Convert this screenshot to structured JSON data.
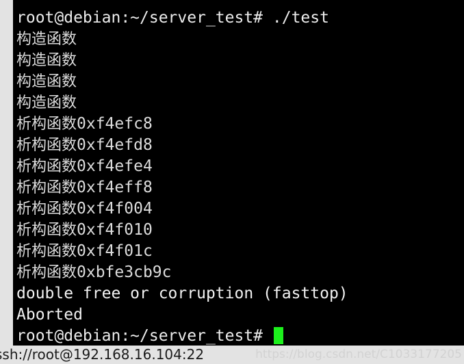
{
  "terminal": {
    "background_color": "#000000",
    "foreground_color": "#e8e8e8",
    "cursor_color": "#1cf01c",
    "lines": [
      {
        "type": "prompt",
        "text": "root@debian:~/server_test# ./test"
      },
      {
        "type": "cjk",
        "text": "构造函数"
      },
      {
        "type": "cjk",
        "text": "构造函数"
      },
      {
        "type": "cjk",
        "text": "构造函数"
      },
      {
        "type": "cjk",
        "text": "构造函数"
      },
      {
        "type": "cjk-addr",
        "cjk": "析构函数",
        "addr": "0xf4efc8"
      },
      {
        "type": "cjk-addr",
        "cjk": "析构函数",
        "addr": "0xf4efd8"
      },
      {
        "type": "cjk-addr",
        "cjk": "析构函数",
        "addr": "0xf4efe4"
      },
      {
        "type": "cjk-addr",
        "cjk": "析构函数",
        "addr": "0xf4eff8"
      },
      {
        "type": "cjk-addr",
        "cjk": "析构函数",
        "addr": "0xf4f004"
      },
      {
        "type": "cjk-addr",
        "cjk": "析构函数",
        "addr": "0xf4f010"
      },
      {
        "type": "cjk-addr",
        "cjk": "析构函数",
        "addr": "0xf4f01c"
      },
      {
        "type": "cjk-addr",
        "cjk": "析构函数",
        "addr": "0xbfe3cb9c"
      },
      {
        "type": "error",
        "text": "double free or corruption (fasttop)"
      },
      {
        "type": "error",
        "text": "Aborted"
      },
      {
        "type": "prompt-cursor",
        "text": "root@debian:~/server_test# "
      }
    ]
  },
  "status_bar": {
    "connection": "ssh://root@192.168.16.104:22",
    "watermark": "https://blog.csdn.net/C1033177205"
  }
}
